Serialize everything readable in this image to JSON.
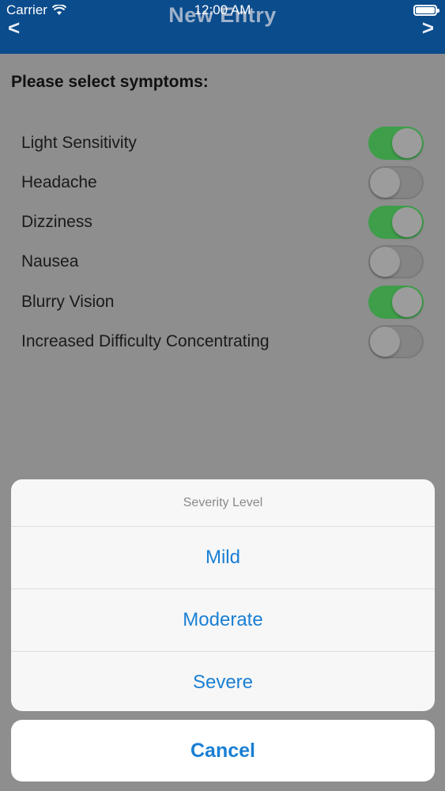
{
  "status_bar": {
    "carrier": "Carrier",
    "time": "12:00 AM"
  },
  "nav": {
    "title": "New Entry",
    "back_label": "<",
    "forward_label": ">"
  },
  "prompt": "Please select symptoms:",
  "symptoms": [
    {
      "label": "Light Sensitivity",
      "on": true
    },
    {
      "label": "Headache",
      "on": false
    },
    {
      "label": "Dizziness",
      "on": true
    },
    {
      "label": "Nausea",
      "on": false
    },
    {
      "label": "Blurry Vision",
      "on": true
    },
    {
      "label": "Increased Difficulty Concentrating",
      "on": false
    }
  ],
  "action_sheet": {
    "title": "Severity Level",
    "options": [
      "Mild",
      "Moderate",
      "Severe"
    ],
    "cancel_label": "Cancel"
  },
  "colors": {
    "nav_bg": "#0b4c8c",
    "switch_on": "#3f9e4a",
    "action_text": "#1a7fd4"
  }
}
